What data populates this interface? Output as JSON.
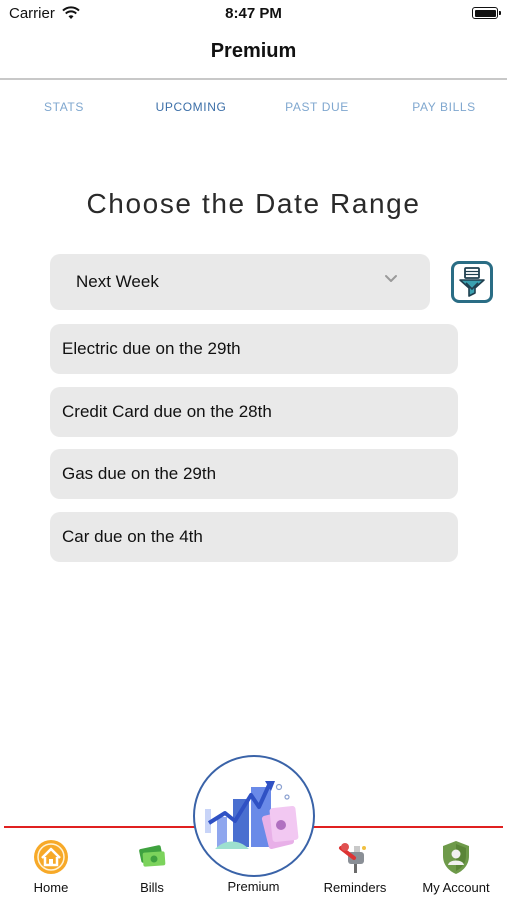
{
  "status_bar": {
    "carrier": "Carrier",
    "time": "8:47 PM"
  },
  "nav": {
    "title": "Premium"
  },
  "tabs": [
    {
      "label": "STATS",
      "active": false
    },
    {
      "label": "UPCOMING",
      "active": true
    },
    {
      "label": "PAST DUE",
      "active": false
    },
    {
      "label": "PAY BILLS",
      "active": false
    }
  ],
  "heading": "Choose the Date Range",
  "date_range": {
    "selected": "Next Week"
  },
  "bills": [
    "Electric due on the 29th",
    "Credit Card due on the 28th",
    "Gas due on the 29th",
    "Car due on the 4th"
  ],
  "bottom_tabs": {
    "home": "Home",
    "bills": "Bills",
    "premium": "Premium",
    "reminders": "Reminders",
    "account": "My Account"
  },
  "colors": {
    "tab_active": "#3c6fa8",
    "tab_inactive": "#7fa7cf",
    "filter_accent": "#2a6d85",
    "tab_bar_line": "#e02020"
  }
}
